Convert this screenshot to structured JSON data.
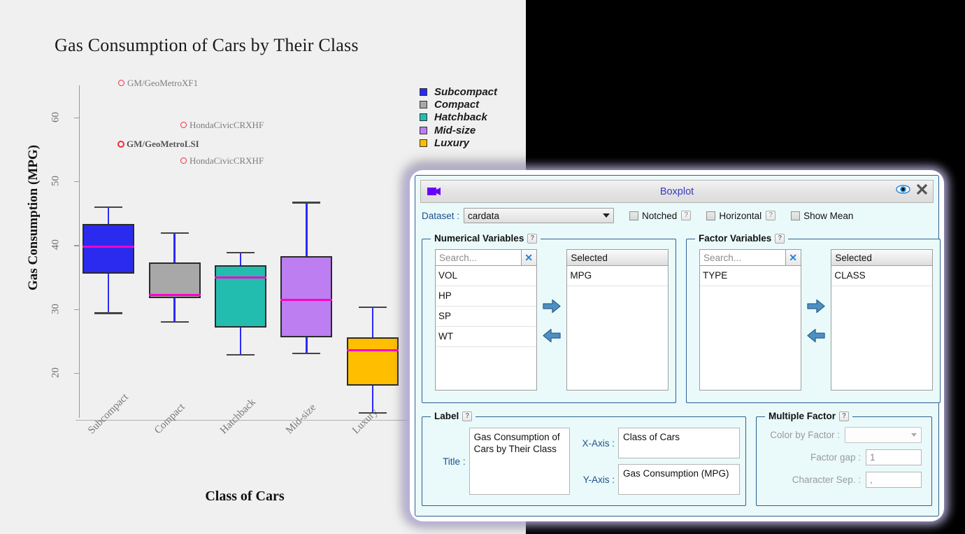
{
  "chart_data": {
    "type": "boxplot",
    "title": "Gas Consumption of Cars by Their Class",
    "xlabel": "Class of Cars",
    "ylabel": "Gas Consumption (MPG)",
    "categories": [
      "Subcompact",
      "Compact",
      "Hatchback",
      "Mid-size",
      "Luxury"
    ],
    "ylim": [
      13,
      65
    ],
    "yticks": [
      20,
      30,
      40,
      50,
      60
    ],
    "grid": false,
    "legend_position": "top-right",
    "colors": {
      "Subcompact": "#2b2bf0",
      "Compact": "#a8a8a8",
      "Hatchback": "#23bdb0",
      "Mid-size": "#bc7ef0",
      "Luxury": "#ffbf00",
      "median": "#ff00c8",
      "whisker": "#2a2aff",
      "outlier_ring": "#ee2b3b"
    },
    "boxes": [
      {
        "category": "Subcompact",
        "min": 29.5,
        "q1": 35.5,
        "median": 39.8,
        "q3": 43.3,
        "max": 46.1
      },
      {
        "category": "Compact",
        "min": 28.1,
        "q1": 31.7,
        "median": 32.2,
        "q3": 37.3,
        "max": 42.0
      },
      {
        "category": "Hatchback",
        "min": 23.0,
        "q1": 27.1,
        "median": 35.0,
        "q3": 36.9,
        "max": 39.0
      },
      {
        "category": "Mid-size",
        "min": 23.2,
        "q1": 25.6,
        "median": 31.4,
        "q3": 38.3,
        "max": 46.8
      },
      {
        "category": "Luxury",
        "min": 13.9,
        "q1": 18.0,
        "median": 23.6,
        "q3": 25.6,
        "max": 30.4
      }
    ],
    "outliers": [
      {
        "label": "GM/GeoMetroXF1",
        "category": "Subcompact",
        "value": 65.4,
        "bold": false
      },
      {
        "label": "HondaCivicCRXHF",
        "category": "Compact",
        "value": 58.9,
        "bold": false
      },
      {
        "label": "GM/GeoMetroLSI",
        "category": "Subcompact",
        "value": 55.9,
        "bold": true
      },
      {
        "label": "HondaCivicCRXHF",
        "category": "Compact",
        "value": 53.3,
        "bold": false
      }
    ],
    "legend": [
      {
        "label": "Subcompact",
        "color": "#2b2bf0"
      },
      {
        "label": "Compact",
        "color": "#a8a8a8"
      },
      {
        "label": "Hatchback",
        "color": "#23bdb0"
      },
      {
        "label": "Mid-size",
        "color": "#bc7ef0"
      },
      {
        "label": "Luxury",
        "color": "#ffbf00"
      }
    ]
  },
  "dialog": {
    "titlebar": {
      "title": "Boxplot",
      "app_icon": "video-camera-icon",
      "preview_icon": "eye-icon",
      "close_icon": "close-icon"
    },
    "options": {
      "dataset_label": "Dataset :",
      "dataset_value": "cardata",
      "checkboxes": [
        {
          "label": "Notched",
          "checked": false,
          "help": "?"
        },
        {
          "label": "Horizontal",
          "checked": false,
          "help": "?"
        },
        {
          "label": "Show Mean",
          "checked": false,
          "help": null
        }
      ]
    },
    "numerical_variables": {
      "legend": "Numerical Variables",
      "help": "?",
      "search_placeholder": "Search...",
      "search_value": "",
      "clear_icon": "clear-icon",
      "available": [
        "VOL",
        "HP",
        "SP",
        "WT"
      ],
      "selected_header": "Selected",
      "selected": [
        "MPG"
      ],
      "add_icon": "arrow-right-icon",
      "remove_icon": "arrow-left-icon"
    },
    "factor_variables": {
      "legend": "Factor Variables",
      "help": "?",
      "search_placeholder": "Search...",
      "search_value": "",
      "clear_icon": "clear-icon",
      "available": [
        "TYPE"
      ],
      "selected_header": "Selected",
      "selected": [
        "CLASS"
      ],
      "add_icon": "arrow-right-icon",
      "remove_icon": "arrow-left-icon"
    },
    "label_section": {
      "legend": "Label",
      "help": "?",
      "title_label": "Title :",
      "title_value": "Gas Consumption of Cars by Their Class",
      "xaxis_label": "X-Axis :",
      "xaxis_value": "Class of Cars",
      "yaxis_label": "Y-Axis :",
      "yaxis_value": "Gas Consumption (MPG)"
    },
    "multiple_factor": {
      "legend": "Multiple Factor",
      "help": "?",
      "color_by_factor_label": "Color by Factor :",
      "color_by_factor_value": "",
      "factor_gap_label": "Factor gap :",
      "factor_gap_value": "1",
      "character_sep_label": "Character Sep. :",
      "character_sep_value": ","
    }
  }
}
